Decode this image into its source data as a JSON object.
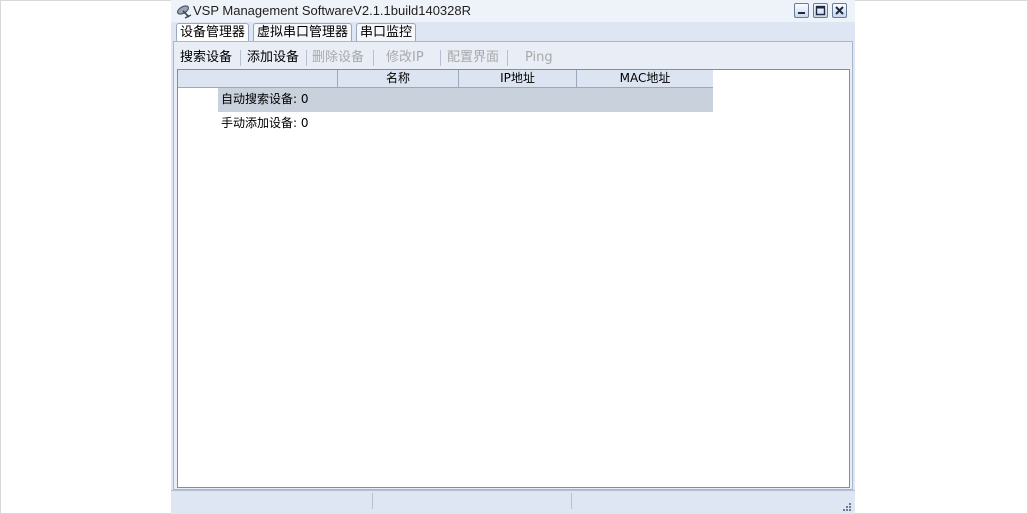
{
  "window": {
    "title": "VSP Management SoftwareV2.1.1build140328R"
  },
  "tabs": [
    {
      "label": "设备管理器",
      "active": true
    },
    {
      "label": "虚拟串口管理器",
      "active": false
    },
    {
      "label": "串口监控",
      "active": false
    }
  ],
  "toolbar": {
    "search": "搜索设备",
    "add": "添加设备",
    "delete": "删除设备",
    "modify_ip": "修改IP",
    "config": "配置界面",
    "ping": "Ping"
  },
  "grid": {
    "columns": [
      "",
      "名称",
      "IP地址",
      "MAC地址"
    ],
    "groups": [
      {
        "label": "自动搜索设备: 0",
        "selected": true
      },
      {
        "label": "手动添加设备: 0",
        "selected": false
      }
    ]
  },
  "colors": {
    "window_bg": "#dfe6f3",
    "selection": "#c9d1dc",
    "disabled_text": "#a9a9a9"
  },
  "icons": {
    "app": "satellite-dish-icon",
    "minimize": "minimize-icon",
    "maximize": "maximize-icon",
    "close": "close-icon",
    "grip": "resize-grip-icon"
  }
}
